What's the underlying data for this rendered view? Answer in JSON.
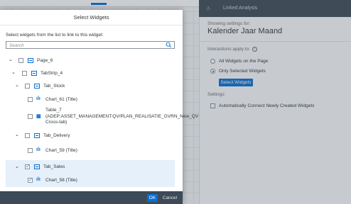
{
  "dialog": {
    "title": "Select Widgets",
    "instruction": "Select widgets from the list to link to this widget:",
    "search_placeholder": "Search",
    "ok_label": "OK",
    "cancel_label": "Cancel",
    "tree": [
      {
        "label": "Page_6",
        "icon": "page-icon",
        "checked": false
      },
      {
        "label": "TabStrip_4",
        "icon": "tabstrip-icon",
        "checked": false
      },
      {
        "label": "Tab_Stock",
        "icon": "tab-icon",
        "checked": false
      },
      {
        "label": "Chart_61 (Title)",
        "icon": "chart-icon",
        "checked": false
      },
      {
        "label": "Table_7 (ADEP:ASSET_MANAGEMENT:QV/PLAN_REALISATIE_GVRN_New_QV Cross-tab)",
        "icon": "table-icon",
        "checked": false
      },
      {
        "label": "Tab_Delivery",
        "icon": "tab-icon",
        "checked": false
      },
      {
        "label": "Chart_59 (Title)",
        "icon": "chart-icon",
        "checked": false
      },
      {
        "label": "Tab_Sales",
        "icon": "tab-icon",
        "checked": true
      },
      {
        "label": "Chart_58 (Title)",
        "icon": "chart-icon",
        "checked": true
      }
    ]
  },
  "side_panel": {
    "header_title": "Linked Analysis",
    "showing_label": "Showing settings for:",
    "widget_name": "Kalender Jaar Maand",
    "interactions_label": "Interactions apply to:",
    "option_all": "All Widgets on the Page",
    "option_selected": "Only Selected Widgets",
    "select_button": "Select Widgets",
    "settings_label": "Settings:",
    "auto_connect_label": "Automatically Connect Newly Created Widgets"
  },
  "colors": {
    "accent": "#0a6ed1",
    "footer": "#3d4a57",
    "selected_row": "#e5f0fa"
  }
}
